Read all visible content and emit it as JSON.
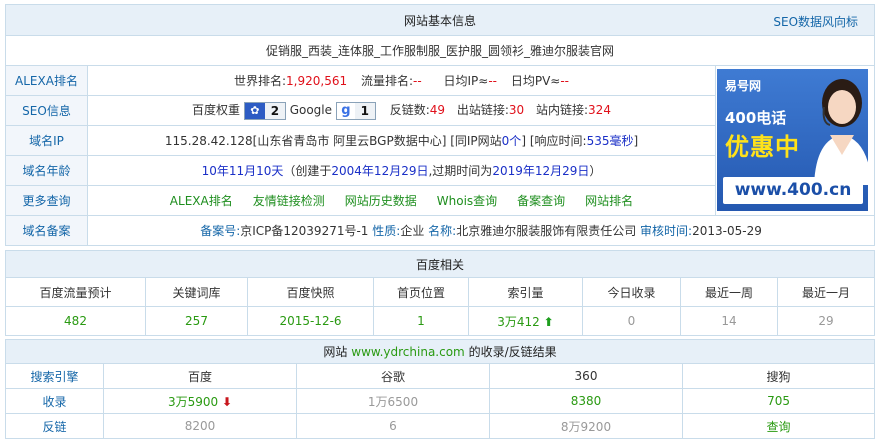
{
  "basic": {
    "title": "网站基本信息",
    "seo_link": "SEO数据风向标",
    "site_title": "促销服_西装_连体服_工作服制服_医护服_圆领衫_雅迪尔服装官网",
    "alexa_label": "ALEXA排名",
    "alexa": {
      "world_rank_label": "世界排名:",
      "world_rank": "1,920,561",
      "traffic_rank_label": "流量排名:",
      "traffic_rank": "--",
      "daily_ip_label": "日均IP≈",
      "daily_ip": "--",
      "daily_pv_label": "日均PV≈",
      "daily_pv": "--"
    },
    "seo_label": "SEO信息",
    "seo": {
      "baidu_weight_label": "百度权重",
      "baidu_weight": "2",
      "google_label": "Google",
      "google_pr": "1",
      "backlinks_label": "反链数:",
      "backlinks": "49",
      "outlinks_label": "出站链接:",
      "outlinks": "30",
      "inlinks_label": "站内链接:",
      "inlinks": "324"
    },
    "ip_label": "域名IP",
    "ip": {
      "address": "115.28.42.128[山东省青岛市 阿里云BGP数据中心]",
      "same_ip_pre": "[同IP网站",
      "same_ip_count": "0个",
      "same_ip_post": "]",
      "response_pre": "[响应时间:",
      "response_time": "535毫秒",
      "response_post": "]"
    },
    "age_label": "域名年龄",
    "age": {
      "age": "10年11月10天",
      "created_pre": "（创建于",
      "created": "2004年12月29日",
      "expire_pre": ",过期时间为",
      "expire": "2019年12月29日",
      "expire_post": "）"
    },
    "more_label": "更多查询",
    "more_links": [
      "ALEXA排名",
      "友情链接检测",
      "网站历史数据",
      "Whois查询",
      "备案查询",
      "网站排名"
    ],
    "icp_label": "域名备案",
    "icp": {
      "no_label": "备案号:",
      "no": "京ICP备12039271号-1",
      "nature_label": "性质:",
      "nature": "企业",
      "name_label": "名称:",
      "name": "北京雅迪尔服装服饰有限责任公司",
      "audit_label": "审核时间:",
      "audit": "2013-05-29"
    }
  },
  "ad": {
    "brand": "易号网",
    "line1": "400电话",
    "line2": "优惠中",
    "url": "www.400.cn"
  },
  "baidu": {
    "title": "百度相关",
    "headers": [
      "百度流量预计",
      "关键词库",
      "百度快照",
      "首页位置",
      "索引量",
      "今日收录",
      "最近一周",
      "最近一月"
    ],
    "values": [
      "482",
      "257",
      "2015-12-6",
      "1",
      "3万412",
      "0",
      "14",
      "29"
    ]
  },
  "index": {
    "title_pre": "网站",
    "domain": "www.ydrchina.com",
    "title_post": "的收录/反链结果",
    "headers": [
      "搜索引擎",
      "百度",
      "谷歌",
      "360",
      "搜狗"
    ],
    "rows": [
      {
        "label": "收录",
        "values": [
          "3万5900",
          "1万6500",
          "8380",
          "705"
        ]
      },
      {
        "label": "反链",
        "values": [
          "8200",
          "6",
          "8万9200",
          "查询"
        ]
      }
    ]
  },
  "colors": {
    "border": "#c9dcea",
    "header_bg": "#e7f0f8",
    "label_color": "#1466a8",
    "red": "#e0101a",
    "green": "#2a9a12",
    "ad_blue": "#2b66c0"
  }
}
